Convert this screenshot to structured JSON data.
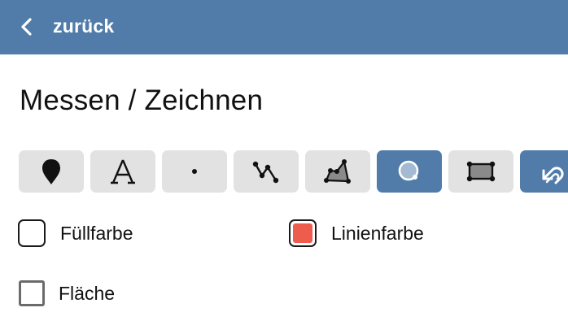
{
  "header": {
    "back_label": "zurück",
    "back_icon": "chevron-left-icon",
    "background_color": "#517ca9"
  },
  "page": {
    "title": "Messen / Zeichnen"
  },
  "toolbar": {
    "active_tool": "circle",
    "active_color": "#517ca9",
    "inactive_color": "#e2e2e2",
    "tools": [
      {
        "id": "marker",
        "icon": "map-pin-icon"
      },
      {
        "id": "text",
        "icon": "text-icon"
      },
      {
        "id": "point",
        "icon": "point-icon"
      },
      {
        "id": "line",
        "icon": "polyline-icon"
      },
      {
        "id": "polygon",
        "icon": "polygon-icon"
      },
      {
        "id": "circle",
        "icon": "circle-icon"
      },
      {
        "id": "rectangle",
        "icon": "rectangle-icon"
      },
      {
        "id": "rotate",
        "icon": "rotate-icon"
      }
    ]
  },
  "styles": {
    "fill": {
      "label": "Füllfarbe",
      "color": "#ffffff"
    },
    "line": {
      "label": "Linienfarbe",
      "color": "#ee5c4d"
    }
  },
  "area": {
    "label": "Fläche",
    "checked": false
  }
}
